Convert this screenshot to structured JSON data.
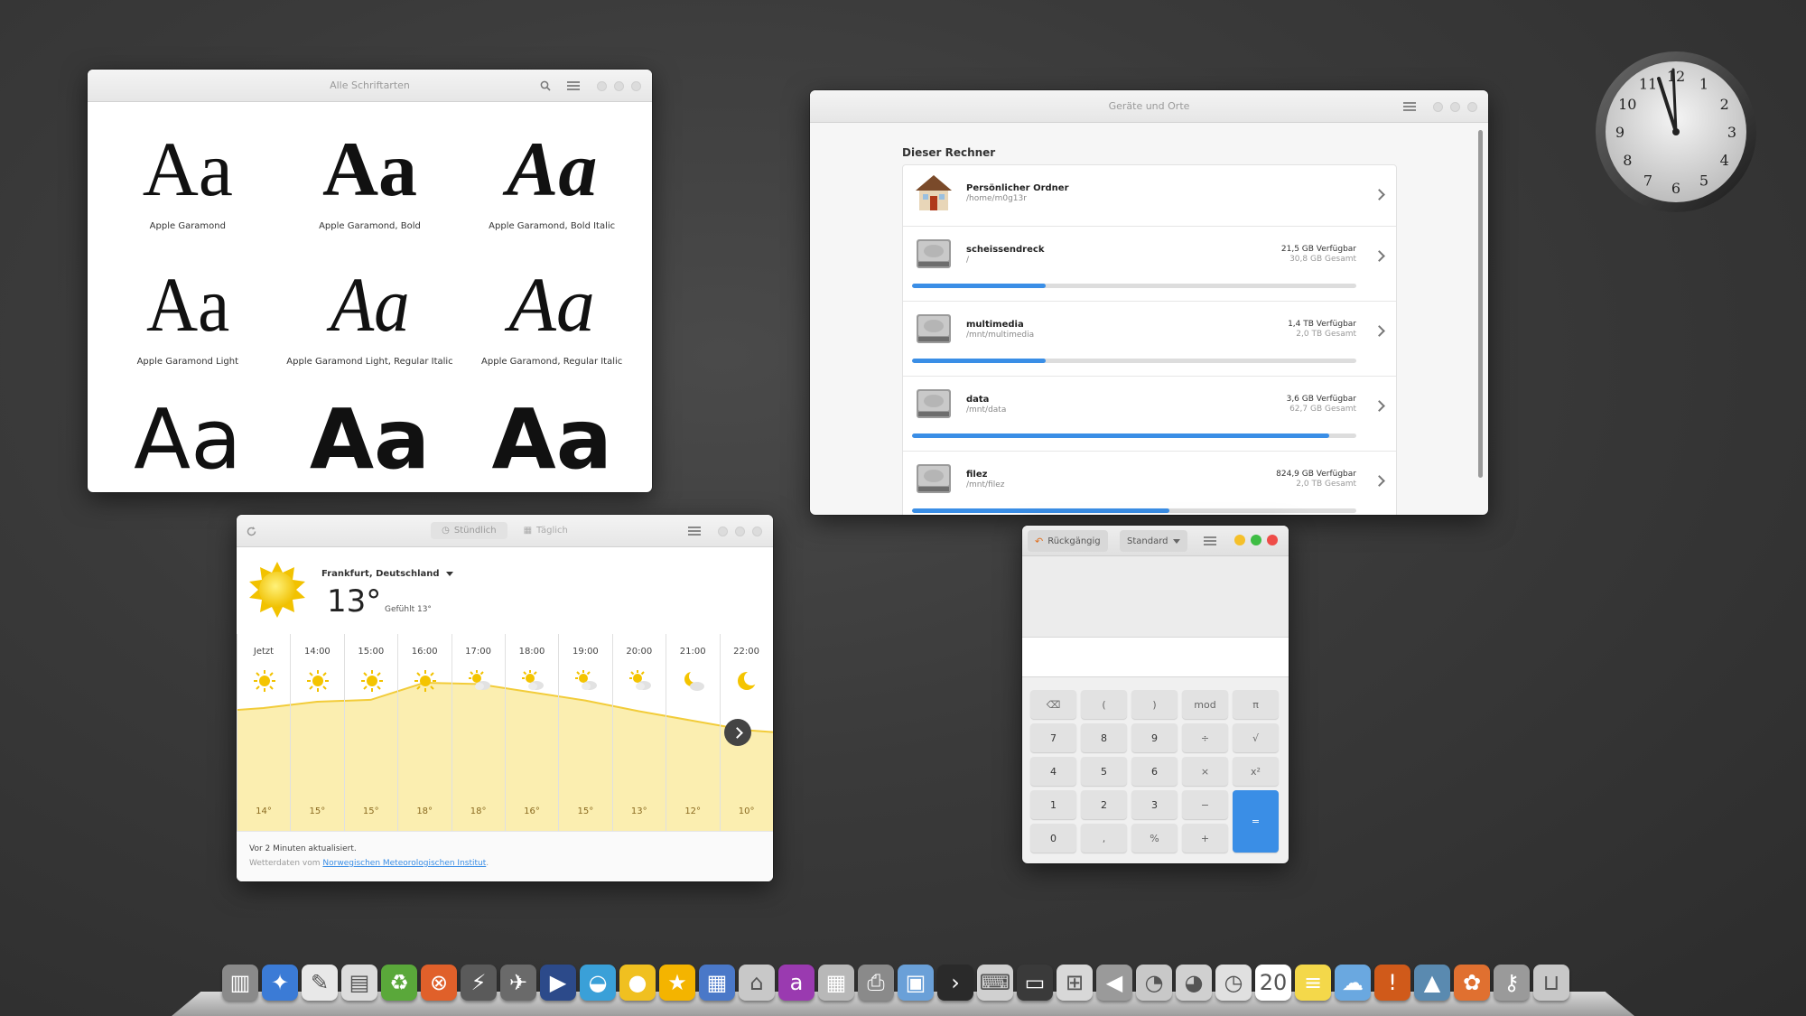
{
  "fonts_window": {
    "title": "Alle Schriftarten",
    "sample": "Aa",
    "fonts": [
      {
        "label": "Apple Garamond",
        "style": "regular"
      },
      {
        "label": "Apple Garamond, Bold",
        "style": "bold"
      },
      {
        "label": "Apple Garamond, Bold Italic",
        "style": "bolditalic"
      },
      {
        "label": "Apple Garamond Light",
        "style": "light"
      },
      {
        "label": "Apple Garamond Light, Regular Italic",
        "style": "lightitalic"
      },
      {
        "label": "Apple Garamond, Regular Italic",
        "style": "italic"
      },
      {
        "label": "",
        "style": "sans"
      },
      {
        "label": "",
        "style": "sansbold"
      },
      {
        "label": "",
        "style": "sansbold"
      }
    ]
  },
  "devices_window": {
    "title": "Geräte und Orte",
    "section": "Dieser Rechner",
    "items": [
      {
        "name": "Persönlicher Ordner",
        "path": "/home/m0g13r",
        "free": "",
        "total": "",
        "usage": null,
        "icon": "home-folder-icon"
      },
      {
        "name": "scheissendreck",
        "path": "/",
        "free": "21,5 GB Verfügbar",
        "total": "30,8 GB Gesamt",
        "usage": 0.3,
        "icon": "hard-drive-icon"
      },
      {
        "name": "multimedia",
        "path": "/mnt/multimedia",
        "free": "1,4 TB Verfügbar",
        "total": "2,0 TB Gesamt",
        "usage": 0.3,
        "icon": "hard-drive-icon"
      },
      {
        "name": "data",
        "path": "/mnt/data",
        "free": "3,6 GB Verfügbar",
        "total": "62,7 GB Gesamt",
        "usage": 0.94,
        "icon": "hard-drive-icon"
      },
      {
        "name": "filez",
        "path": "/mnt/filez",
        "free": "824,9 GB Verfügbar",
        "total": "2,0 TB Gesamt",
        "usage": 0.58,
        "icon": "hard-drive-icon"
      }
    ]
  },
  "weather_window": {
    "tabs": [
      {
        "label": "Stündlich",
        "active": true
      },
      {
        "label": "Täglich",
        "active": false
      }
    ],
    "location": "Frankfurt, Deutschland",
    "temperature": "13°",
    "feels_like": "Gefühlt 13°",
    "hours": [
      {
        "time": "Jetzt",
        "temp": "14°",
        "value": 14,
        "icon": "sun-icon"
      },
      {
        "time": "14:00",
        "temp": "15°",
        "value": 15,
        "icon": "sun-icon"
      },
      {
        "time": "15:00",
        "temp": "15°",
        "value": 15.3,
        "icon": "sun-icon"
      },
      {
        "time": "16:00",
        "temp": "18°",
        "value": 18,
        "icon": "sun-icon"
      },
      {
        "time": "17:00",
        "temp": "18°",
        "value": 17.8,
        "icon": "sun-cloud-icon"
      },
      {
        "time": "18:00",
        "temp": "16°",
        "value": 16.5,
        "icon": "sun-cloud-icon"
      },
      {
        "time": "19:00",
        "temp": "15°",
        "value": 15.2,
        "icon": "sun-cloud-icon"
      },
      {
        "time": "20:00",
        "temp": "13°",
        "value": 13.5,
        "icon": "sun-cloud-icon"
      },
      {
        "time": "21:00",
        "temp": "12°",
        "value": 12,
        "icon": "moon-cloud-icon"
      },
      {
        "time": "22:00",
        "temp": "10°",
        "value": 10.5,
        "icon": "moon-icon"
      }
    ],
    "updated": "Vor 2 Minuten aktualisiert.",
    "source_prefix": "Wetterdaten vom",
    "source_link": "Norwegischen Meteorologischen Institut",
    "source_suffix": "."
  },
  "calculator_window": {
    "undo_label": "Rückgängig",
    "mode_label": "Standard",
    "keys": [
      "⌫",
      "(",
      ")",
      "mod",
      "π",
      "7",
      "8",
      "9",
      "÷",
      "√",
      "4",
      "5",
      "6",
      "×",
      "x²",
      "1",
      "2",
      "3",
      "−",
      "=",
      "0",
      ",",
      "%",
      "+"
    ]
  },
  "clock": {
    "numerals": [
      "12",
      "1",
      "2",
      "3",
      "4",
      "5",
      "6",
      "7",
      "8",
      "9",
      "10",
      "11"
    ]
  },
  "dock": {
    "items": [
      {
        "icon": "books-icon",
        "color": "#8a8a8a",
        "glyph": "▥"
      },
      {
        "icon": "safari-icon",
        "color": "#3b7bd6",
        "glyph": "✦"
      },
      {
        "icon": "text-editor-icon",
        "color": "#e8e8e8",
        "glyph": "✎"
      },
      {
        "icon": "news-icon",
        "color": "#dcdcdc",
        "glyph": "▤"
      },
      {
        "icon": "recycle-icon",
        "color": "#5aa83a",
        "glyph": "♻"
      },
      {
        "icon": "lifebuoy-icon",
        "color": "#e0602a",
        "glyph": "⊗"
      },
      {
        "icon": "lightning-icon",
        "color": "#5a5a5a",
        "glyph": "⚡"
      },
      {
        "icon": "plane-icon",
        "color": "#6a6a6a",
        "glyph": "✈"
      },
      {
        "icon": "video-icon",
        "color": "#2c4a8a",
        "glyph": "▶"
      },
      {
        "icon": "tub-icon",
        "color": "#3aa0d8",
        "glyph": "◒"
      },
      {
        "icon": "duck-icon",
        "color": "#f0c020",
        "glyph": "●"
      },
      {
        "icon": "star-icon",
        "color": "#f4b400",
        "glyph": "★"
      },
      {
        "icon": "archive-icon",
        "color": "#4a78c8",
        "glyph": "▦"
      },
      {
        "icon": "home-icon",
        "color": "#c8c8c8",
        "glyph": "⌂"
      },
      {
        "icon": "font-book-icon",
        "color": "#9a3ab0",
        "glyph": "a"
      },
      {
        "icon": "calculator-icon",
        "color": "#b8b8b8",
        "glyph": "▦"
      },
      {
        "icon": "printer-icon",
        "color": "#8a8a8a",
        "glyph": "⎙"
      },
      {
        "icon": "finder-icon",
        "color": "#6aa0d8",
        "glyph": "▣"
      },
      {
        "icon": "terminal-icon",
        "color": "#2a2a2a",
        "glyph": "›"
      },
      {
        "icon": "keyboard-icon",
        "color": "#d0d0d0",
        "glyph": "⌨"
      },
      {
        "icon": "window-icon",
        "color": "#3a3a3a",
        "glyph": "▭"
      },
      {
        "icon": "clapper-icon",
        "color": "#d8d8d8",
        "glyph": "⊞"
      },
      {
        "icon": "speaker-icon",
        "color": "#9a9a9a",
        "glyph": "◀"
      },
      {
        "icon": "gauge-icon",
        "color": "#c8c8c8",
        "glyph": "◔"
      },
      {
        "icon": "speedometer-icon",
        "color": "#d0d0d0",
        "glyph": "◕"
      },
      {
        "icon": "clock-icon",
        "color": "#e0e0e0",
        "glyph": "◷"
      },
      {
        "icon": "calendar-icon",
        "color": "#ffffff",
        "glyph": "20"
      },
      {
        "icon": "notes-icon",
        "color": "#f4d84a",
        "glyph": "≡"
      },
      {
        "icon": "weather-icon",
        "color": "#6aa8e0",
        "glyph": "☁"
      },
      {
        "icon": "football-icon",
        "color": "#d05a1a",
        "glyph": "!"
      },
      {
        "icon": "screen-icon",
        "color": "#5a8ab0",
        "glyph": "▲"
      },
      {
        "icon": "bug-icon",
        "color": "#e07030",
        "glyph": "✿"
      },
      {
        "icon": "keys-icon",
        "color": "#9a9a9a",
        "glyph": "⚷"
      },
      {
        "icon": "trash-icon",
        "color": "#c8c8c8",
        "glyph": "⊔"
      }
    ]
  }
}
